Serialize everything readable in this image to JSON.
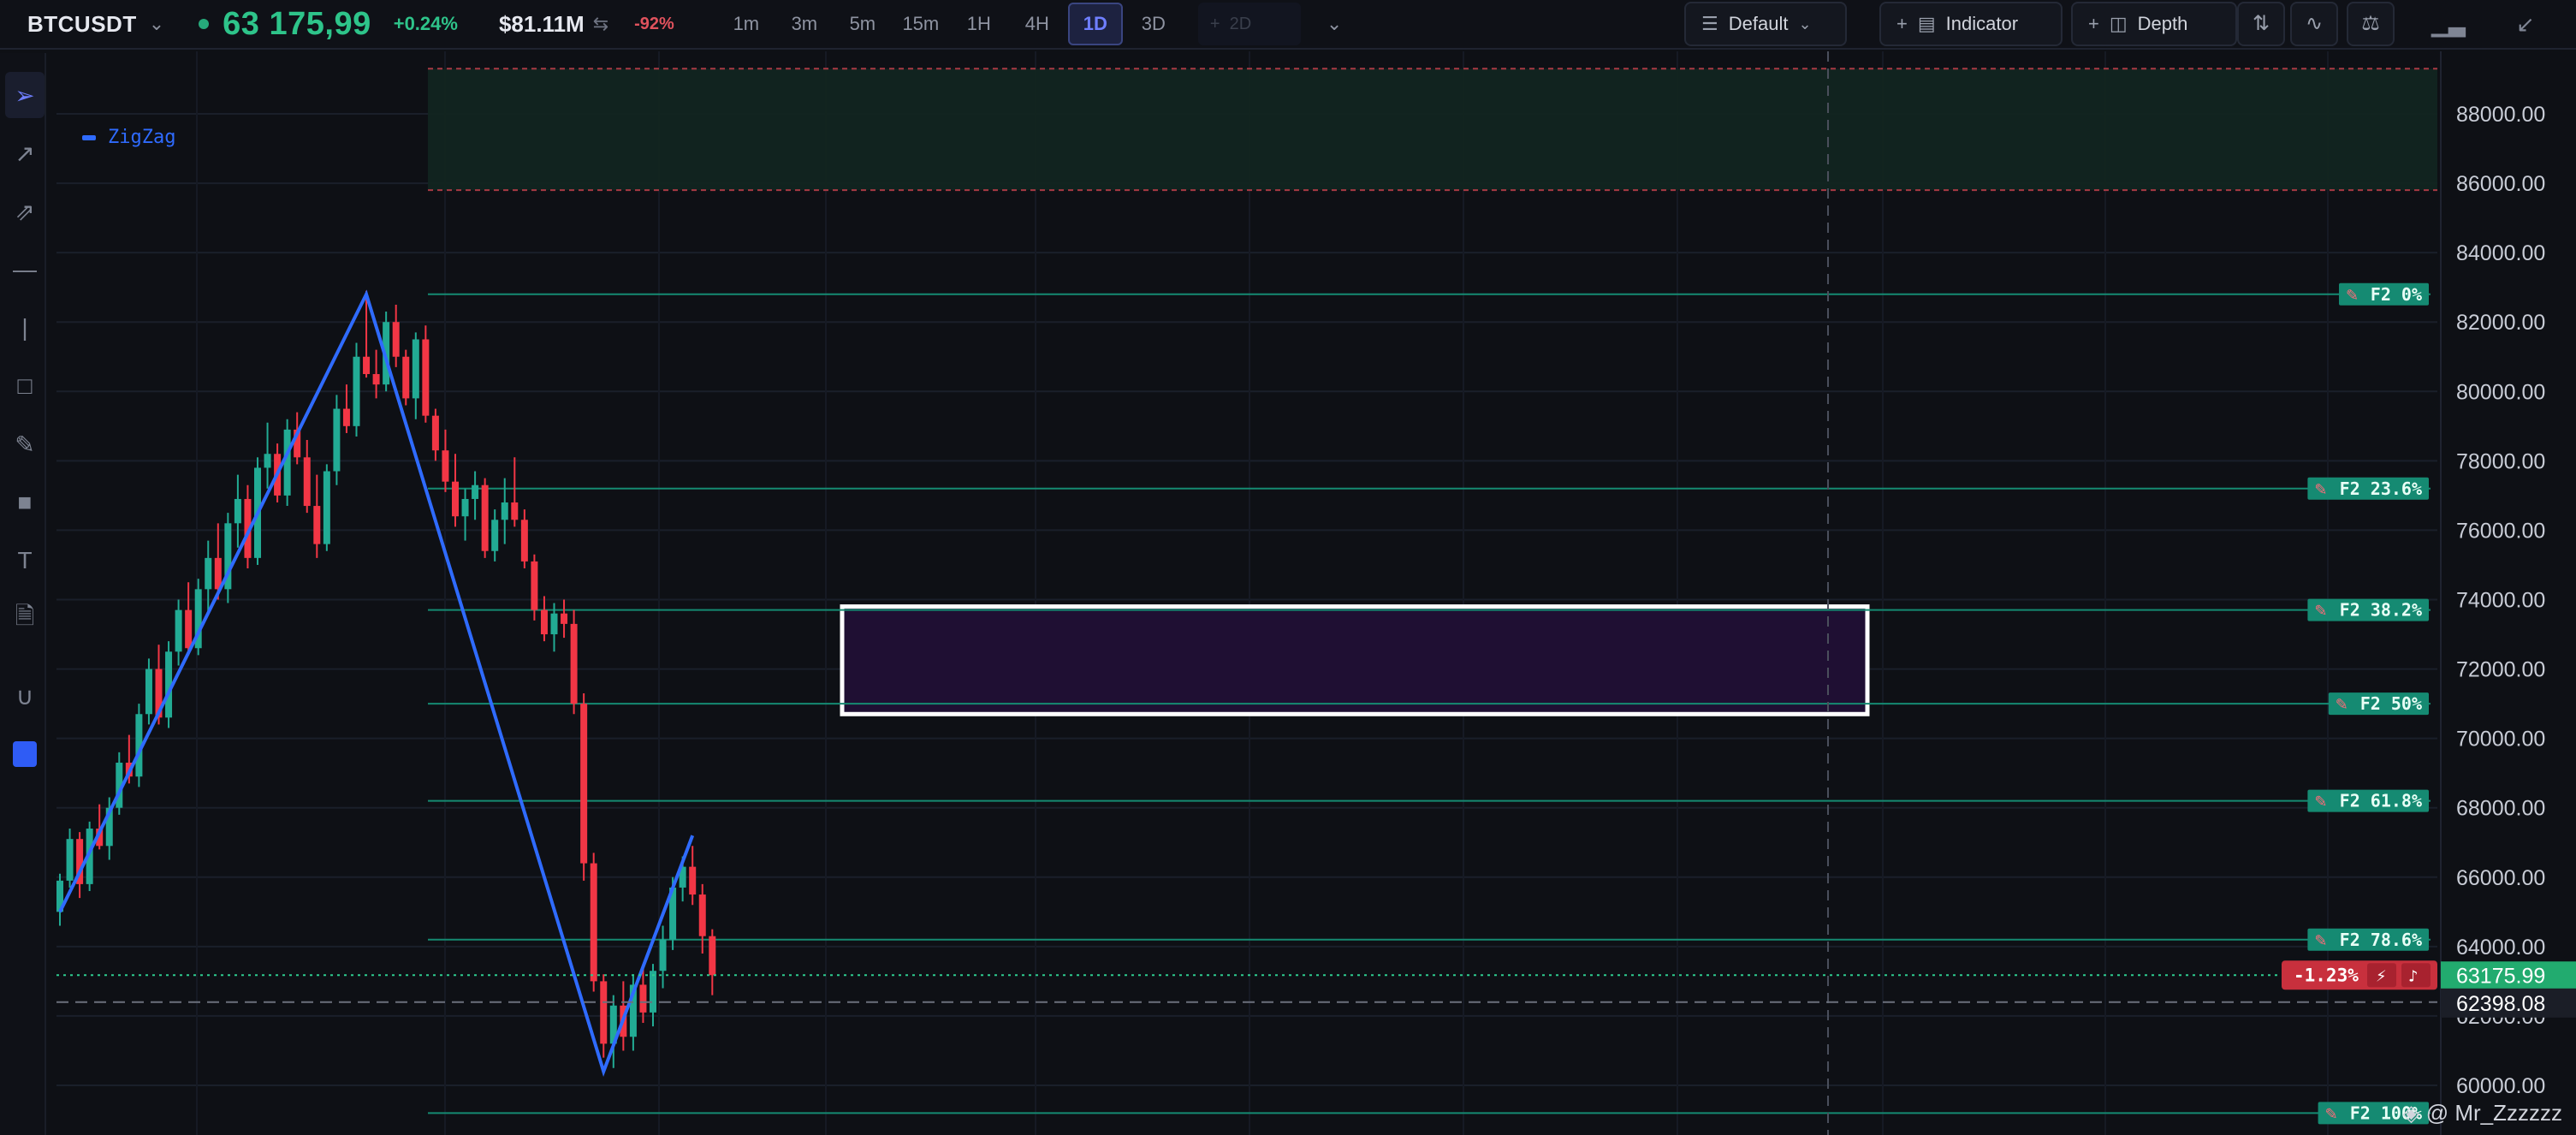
{
  "header": {
    "symbol": "BTCUSDT",
    "price": "63 175,99",
    "change_pct": "+0.24%",
    "volume": "$81.11M",
    "volume_change": "-92%",
    "timeframes": [
      "1m",
      "3m",
      "5m",
      "15m",
      "1H",
      "4H",
      "1D",
      "3D"
    ],
    "active_timeframe": "1D",
    "add_timeframe": "2D",
    "template_label": "Default",
    "indicator_label": "Indicator",
    "depth_label": "Depth"
  },
  "sidebar": {
    "tools": [
      "cursor-icon",
      "trend-line-icon",
      "ray-icon",
      "horizontal-line-icon",
      "vertical-line-icon",
      "rectangle-icon",
      "brush-icon",
      "ruler-icon",
      "text-icon",
      "note-icon",
      "magnet-icon",
      "color-swatch"
    ]
  },
  "legend": {
    "zigzag_label": "ZigZag"
  },
  "chart_data": {
    "type": "candlestick",
    "symbol": "BTCUSDT",
    "y_axis": {
      "ticks": [
        "88000.00",
        "86000.00",
        "84000.00",
        "82000.00",
        "80000.00",
        "78000.00",
        "76000.00",
        "74000.00",
        "72000.00",
        "70000.00",
        "68000.00",
        "66000.00",
        "64000.00",
        "62000.00",
        "60000.00"
      ],
      "range": [
        59200,
        89600
      ]
    },
    "candles": [
      [
        65000,
        66100,
        64600,
        65900
      ],
      [
        65900,
        67400,
        65700,
        67100
      ],
      [
        67100,
        67300,
        65400,
        65800
      ],
      [
        65800,
        67600,
        65600,
        67400
      ],
      [
        67400,
        68100,
        66800,
        66900
      ],
      [
        66900,
        68300,
        66500,
        68000
      ],
      [
        68000,
        69600,
        67800,
        69300
      ],
      [
        69300,
        70100,
        68700,
        68900
      ],
      [
        68900,
        71000,
        68600,
        70700
      ],
      [
        70700,
        72300,
        70400,
        72000
      ],
      [
        72000,
        72700,
        70400,
        70600
      ],
      [
        70600,
        72800,
        70300,
        72500
      ],
      [
        72500,
        74000,
        72100,
        73700
      ],
      [
        73700,
        74500,
        72400,
        72600
      ],
      [
        72600,
        74600,
        72400,
        74300
      ],
      [
        74300,
        75700,
        73600,
        75200
      ],
      [
        75200,
        76200,
        74000,
        74300
      ],
      [
        74300,
        76500,
        73900,
        76200
      ],
      [
        76200,
        77600,
        75500,
        76900
      ],
      [
        76900,
        77300,
        74900,
        75200
      ],
      [
        75200,
        78100,
        75000,
        77800
      ],
      [
        77800,
        79100,
        77200,
        78200
      ],
      [
        78200,
        78500,
        76800,
        77000
      ],
      [
        77000,
        79200,
        76700,
        78900
      ],
      [
        78900,
        79400,
        77900,
        78100
      ],
      [
        78100,
        78600,
        76500,
        76700
      ],
      [
        76700,
        77600,
        75200,
        75600
      ],
      [
        75600,
        77900,
        75400,
        77700
      ],
      [
        77700,
        79900,
        77300,
        79500
      ],
      [
        79500,
        80200,
        78800,
        79000
      ],
      [
        79000,
        81400,
        78700,
        81000
      ],
      [
        81000,
        82900,
        80400,
        80500
      ],
      [
        80500,
        81200,
        79800,
        80200
      ],
      [
        80200,
        82300,
        80000,
        82000
      ],
      [
        82000,
        82500,
        80700,
        81000
      ],
      [
        81000,
        81200,
        79600,
        79800
      ],
      [
        79800,
        81700,
        79200,
        81500
      ],
      [
        81500,
        81900,
        79100,
        79300
      ],
      [
        79300,
        79500,
        78000,
        78300
      ],
      [
        78300,
        78900,
        77100,
        77400
      ],
      [
        77400,
        78200,
        76100,
        76400
      ],
      [
        76400,
        77200,
        75700,
        76900
      ],
      [
        76900,
        77700,
        76300,
        77300
      ],
      [
        77300,
        77500,
        75200,
        75400
      ],
      [
        75400,
        76600,
        75100,
        76300
      ],
      [
        76300,
        77500,
        75600,
        76800
      ],
      [
        76800,
        78100,
        76100,
        76300
      ],
      [
        76300,
        76600,
        74900,
        75100
      ],
      [
        75100,
        75300,
        73400,
        73700
      ],
      [
        73700,
        74100,
        72800,
        73000
      ],
      [
        73000,
        73900,
        72500,
        73600
      ],
      [
        73600,
        74000,
        72900,
        73300
      ],
      [
        73300,
        73700,
        70700,
        71000
      ],
      [
        71000,
        71300,
        65900,
        66400
      ],
      [
        66400,
        66700,
        62700,
        63000
      ],
      [
        63000,
        63200,
        60800,
        61200
      ],
      [
        61200,
        62600,
        60500,
        62300
      ],
      [
        62300,
        63000,
        61000,
        61400
      ],
      [
        61400,
        63200,
        61000,
        62900
      ],
      [
        62900,
        63500,
        61800,
        62100
      ],
      [
        62100,
        63500,
        61700,
        63300
      ],
      [
        63300,
        64600,
        62800,
        64200
      ],
      [
        64200,
        66000,
        63900,
        65700
      ],
      [
        65700,
        66600,
        65300,
        66300
      ],
      [
        66300,
        66900,
        65200,
        65500
      ],
      [
        65500,
        65800,
        63800,
        64300
      ],
      [
        64300,
        64500,
        62600,
        63176
      ]
    ],
    "zigzag": [
      {
        "index": 0,
        "price": 65000
      },
      {
        "index": 31,
        "price": 82800
      },
      {
        "index": 55,
        "price": 60400
      },
      {
        "index": 64,
        "price": 67200
      }
    ],
    "fibonacci": {
      "levels": [
        {
          "label": "F2 0%",
          "price": 82800
        },
        {
          "label": "F2 23.6%",
          "price": 77200
        },
        {
          "label": "F2 38.2%",
          "price": 73700
        },
        {
          "label": "F2 50%",
          "price": 71000
        },
        {
          "label": "F2 61.8%",
          "price": 68200
        },
        {
          "label": "F2 78.6%",
          "price": 64200
        },
        {
          "label": "F2 100%",
          "price": 59200
        }
      ]
    },
    "zone_top": {
      "from": 85800,
      "to": 89300
    },
    "box": {
      "from": 70700,
      "to": 73800
    },
    "current_price": "63175.99",
    "crosshair_price": "62398.08",
    "price_change_badge": "-1.23%",
    "colors": {
      "up": "#22ab94",
      "down": "#f23645",
      "zigzag": "#2f6bff",
      "fib": "#158a72"
    }
  },
  "watermark": "@ Mr_Zzzzzz"
}
